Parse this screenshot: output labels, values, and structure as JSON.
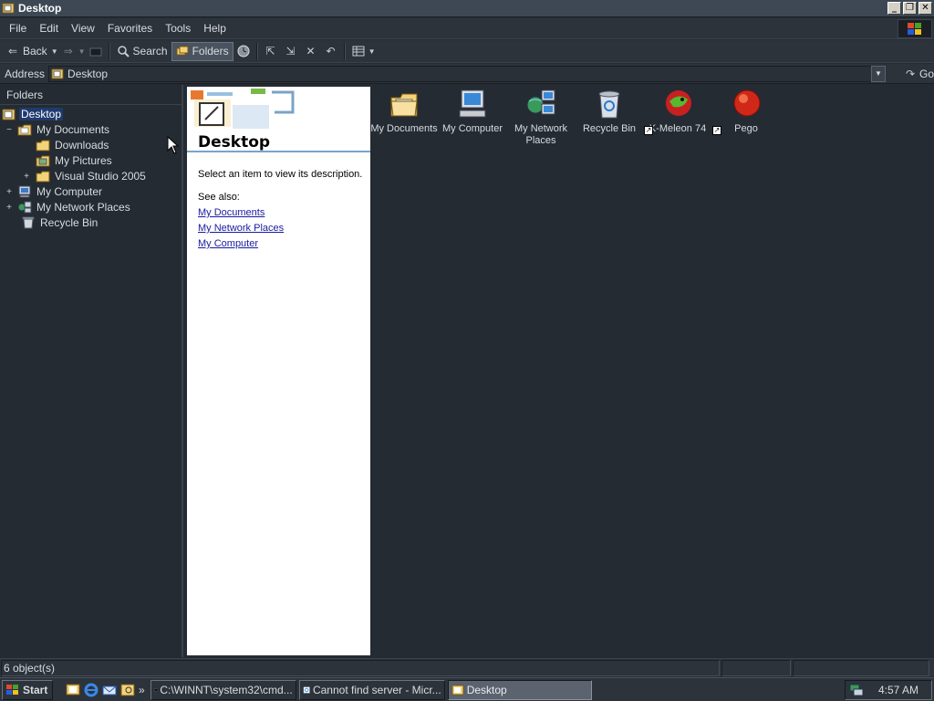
{
  "window": {
    "title": "Desktop"
  },
  "menubar": {
    "items": [
      "File",
      "Edit",
      "View",
      "Favorites",
      "Tools",
      "Help"
    ]
  },
  "toolbar": {
    "back_label": "Back",
    "search_label": "Search",
    "folders_label": "Folders"
  },
  "address": {
    "label": "Address",
    "value": "Desktop",
    "go_label": "Go"
  },
  "folders_pane": {
    "header": "Folders",
    "items": [
      {
        "label": "Desktop",
        "expander": "",
        "selected": true
      },
      {
        "label": "My Documents",
        "expander": "−"
      },
      {
        "label": "Downloads",
        "expander": ""
      },
      {
        "label": "My Pictures",
        "expander": ""
      },
      {
        "label": "Visual Studio 2005",
        "expander": "+"
      },
      {
        "label": "My Computer",
        "expander": "+"
      },
      {
        "label": "My Network Places",
        "expander": "+"
      },
      {
        "label": "Recycle Bin",
        "expander": ""
      }
    ]
  },
  "webview": {
    "title": "Desktop",
    "description": "Select an item to view its description.",
    "see_also": "See also:",
    "links": [
      "My Documents",
      "My Network Places",
      "My Computer"
    ]
  },
  "icons": [
    {
      "label": "My Documents",
      "icon": "my-documents-icon"
    },
    {
      "label": "My Computer",
      "icon": "my-computer-icon"
    },
    {
      "label": "My Network Places",
      "icon": "network-places-icon"
    },
    {
      "label": "Recycle Bin",
      "icon": "recycle-bin-icon"
    },
    {
      "label": "K-Meleon 74",
      "icon": "k-meleon-icon"
    },
    {
      "label": "Pego",
      "icon": "pego-icon"
    }
  ],
  "statusbar": {
    "text": "6 object(s)"
  },
  "taskbar": {
    "start_label": "Start",
    "chevron": "»",
    "tasks": [
      {
        "label": "C:\\WINNT\\system32\\cmd...",
        "active": false
      },
      {
        "label": "Cannot find server - Micr...",
        "active": false
      },
      {
        "label": "Desktop",
        "active": true
      }
    ],
    "clock": "4:57 AM"
  },
  "colors": {
    "selection": "#1f3a6e",
    "link": "#1a1aa0",
    "background": "#252b33"
  }
}
